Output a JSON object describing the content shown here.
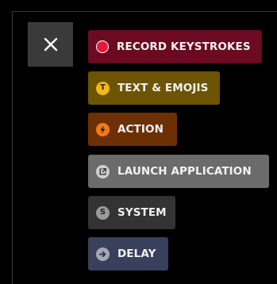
{
  "close_button": {
    "icon": "close-icon"
  },
  "menu": {
    "items": [
      {
        "label": "RECORD KEYSTROKES",
        "icon": "record-dot-icon",
        "bg": "#6b0a21",
        "icon_bg": "#e8173e"
      },
      {
        "label": "TEXT & EMOJIS",
        "icon": "text-t-icon",
        "icon_glyph": "T",
        "bg": "#6d5405",
        "icon_bg": "#f1b81b"
      },
      {
        "label": "ACTION",
        "icon": "lightning-icon",
        "bg": "#6d3005",
        "icon_bg": "#f07a1a"
      },
      {
        "label": "LAUNCH APPLICATION",
        "icon": "launch-external-icon",
        "bg": "#6b6b6b",
        "icon_bg": "#cfcfcf"
      },
      {
        "label": "SYSTEM",
        "icon": "system-s-icon",
        "icon_glyph": "S",
        "bg": "#333333",
        "icon_bg": "#9a9a9a"
      },
      {
        "label": "DELAY",
        "icon": "arrow-right-icon",
        "bg": "#39405c",
        "icon_bg": "#a4a8b6"
      }
    ]
  }
}
